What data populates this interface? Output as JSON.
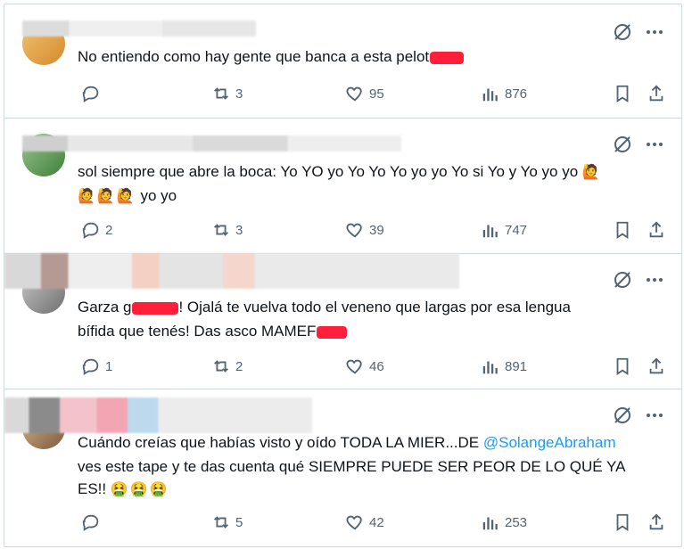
{
  "posts": [
    {
      "text_lines": [
        "No entiendo como hay gente que banca a esta pelot"
      ],
      "replies": "",
      "reposts": "3",
      "likes": "95",
      "views": "876"
    },
    {
      "text_lines": [
        "sol siempre que abre la boca: Yo YO yo Yo Yo Yo yo yo Yo si Yo y Yo yo yo",
        "yo yo"
      ],
      "replies": "2",
      "reposts": "3",
      "likes": "39",
      "views": "747"
    },
    {
      "text_line1_a": "Garza g",
      "text_line1_b": "! Ojalá te vuelva todo el veneno que largas por esa lengua",
      "text_line2": "bífida que tenés! Das asco MAMEF",
      "replies": "1",
      "reposts": "2",
      "likes": "46",
      "views": "891"
    },
    {
      "text_line1": "Cuándo creías que habías visto y oído TODA LA MIER...DE",
      "mention": "@SolangeAbraham",
      "text_line2": "ves este tape y te das cuenta qué SIEMPRE PUEDE SER PEOR DE LO QUÉ YA",
      "text_line3": "ES!!",
      "replies": "",
      "reposts": "5",
      "likes": "42",
      "views": "253"
    }
  ],
  "icons": {
    "reply": "reply-icon",
    "repost": "repost-icon",
    "like": "heart-icon",
    "views": "views-icon",
    "bookmark": "bookmark-icon",
    "share": "share-icon",
    "grok": "grok-icon",
    "more": "more-icon"
  },
  "colors": {
    "text": "#0f1419",
    "muted": "#536471",
    "link": "#1d9bf0",
    "divider": "#cfd9de",
    "redaction": "#ff1f3a"
  }
}
